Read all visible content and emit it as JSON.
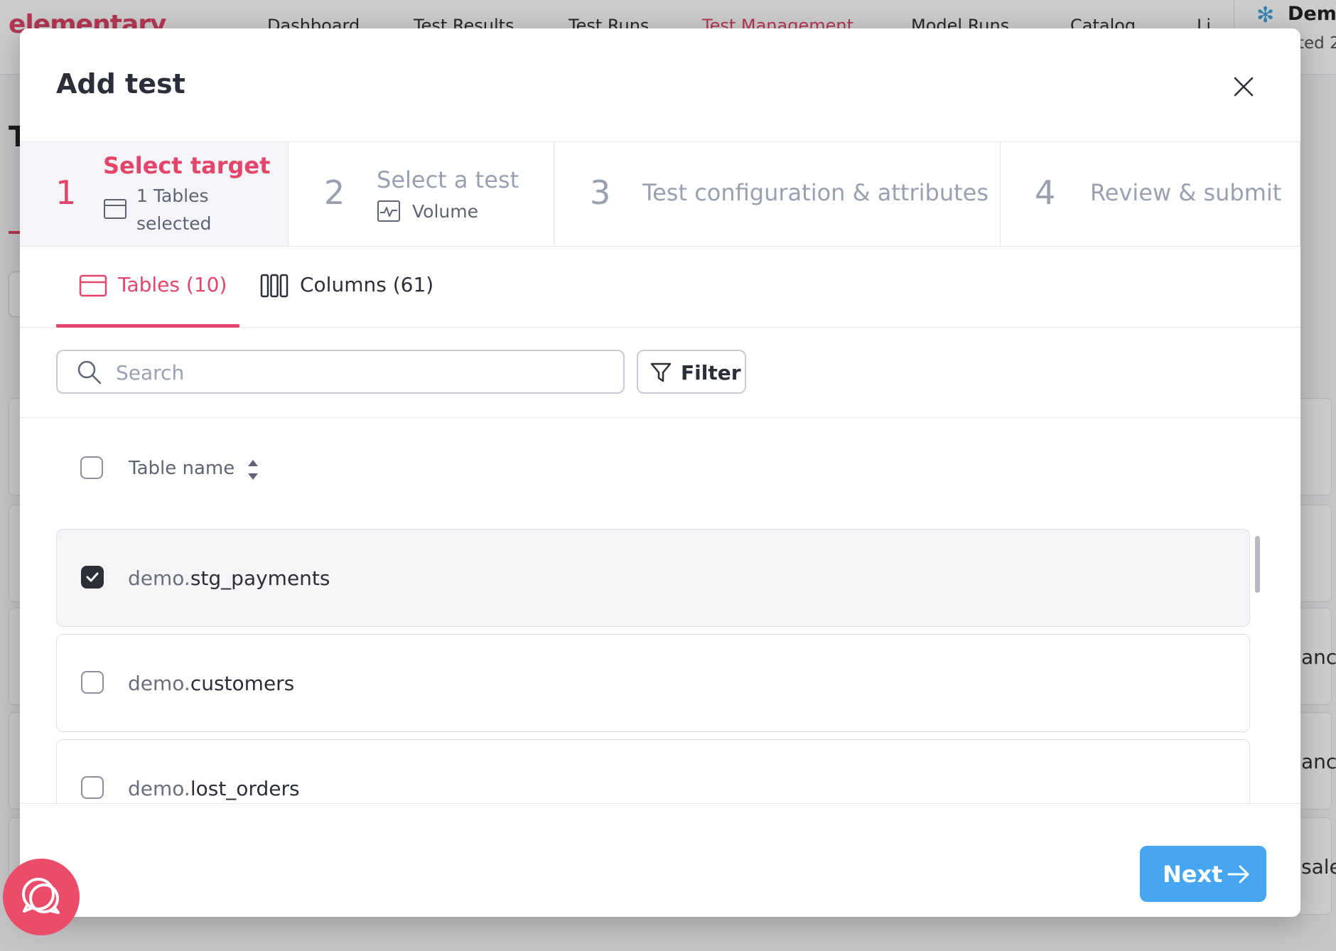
{
  "background": {
    "logo": "elementary",
    "nav": [
      "Dashboard",
      "Test Results",
      "Test Runs",
      "Test Management",
      "Model Runs",
      "Catalog",
      "Li"
    ],
    "env_title": "Demo",
    "env_sub": "ted 2",
    "page_title_initial": "T",
    "card_snippets": [
      "ance",
      "ance",
      "sales"
    ]
  },
  "modal": {
    "title": "Add test",
    "close_label": "×"
  },
  "stepper": {
    "steps": [
      {
        "number": "1",
        "title": "Select target",
        "sub_line1": "1 Tables",
        "sub_line2": "selected",
        "icon": "table-icon"
      },
      {
        "number": "2",
        "title": "Select a test",
        "sub_line1": "Volume",
        "icon": "volume-chart-icon"
      },
      {
        "number": "3",
        "title": "Test configuration & attributes"
      },
      {
        "number": "4",
        "title": "Review & submit"
      }
    ]
  },
  "tabs": [
    {
      "label": "Tables (10)",
      "icon": "table-icon",
      "active": true
    },
    {
      "label": "Columns (61)",
      "icon": "columns-icon",
      "active": false
    }
  ],
  "search": {
    "placeholder": "Search",
    "value": ""
  },
  "filter": {
    "label": "Filter"
  },
  "table": {
    "header": "Table name",
    "rows": [
      {
        "schema": "demo.",
        "name": "stg_payments",
        "checked": true
      },
      {
        "schema": "demo.",
        "name": "customers",
        "checked": false
      },
      {
        "schema": "demo.",
        "name": "lost_orders",
        "checked": false
      }
    ]
  },
  "footer": {
    "next_label": "Next"
  },
  "colors": {
    "accent": "#e3456b",
    "primary_button": "#46a6f2",
    "text": "#2c2f38"
  }
}
